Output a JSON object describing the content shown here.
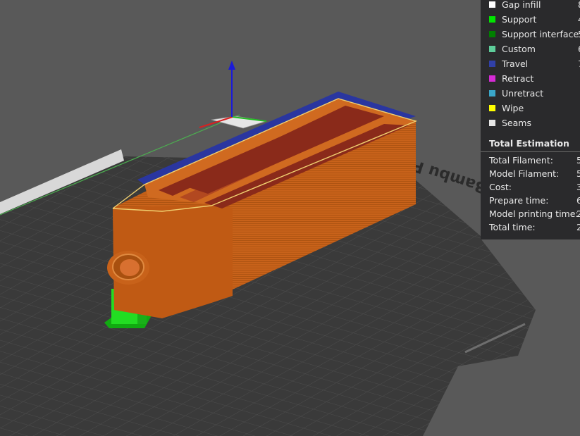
{
  "legend": {
    "items": [
      {
        "label": "Gap infill",
        "color": "#ffffff",
        "value": "8"
      },
      {
        "label": "Support",
        "color": "#00e600",
        "value": "4"
      },
      {
        "label": "Support interface",
        "color": "#008000",
        "value": "5"
      },
      {
        "label": "Custom",
        "color": "#5ecd9a",
        "value": "6"
      },
      {
        "label": "Travel",
        "color": "#3040a8",
        "value": "7"
      },
      {
        "label": "Retract",
        "color": "#d62bd6",
        "value": ""
      },
      {
        "label": "Unretract",
        "color": "#3aa6c9",
        "value": ""
      },
      {
        "label": "Wipe",
        "color": "#ffff00",
        "value": ""
      },
      {
        "label": "Seams",
        "color": "#e6e6e6",
        "value": ""
      }
    ]
  },
  "estimation": {
    "title": "Total Estimation",
    "rows": [
      {
        "label": "Total Filament:",
        "value": "5"
      },
      {
        "label": "Model Filament:",
        "value": "5"
      },
      {
        "label": "Cost:",
        "value": "3"
      },
      {
        "label": "Prepare time:",
        "value": "6"
      },
      {
        "label": "Model printing time:",
        "value": "2"
      },
      {
        "label": "Total time:",
        "value": "2"
      }
    ]
  },
  "plate": {
    "bed_logo_text": "Bambu PEI Plate"
  },
  "colors": {
    "background": "#595959",
    "bed": "#3a3a3a",
    "model": "#c8621a",
    "top_inner": "#8a2a1a",
    "support": "#22cc22",
    "axis_z": "#1a1ad8",
    "axis_x": "#d82020"
  }
}
